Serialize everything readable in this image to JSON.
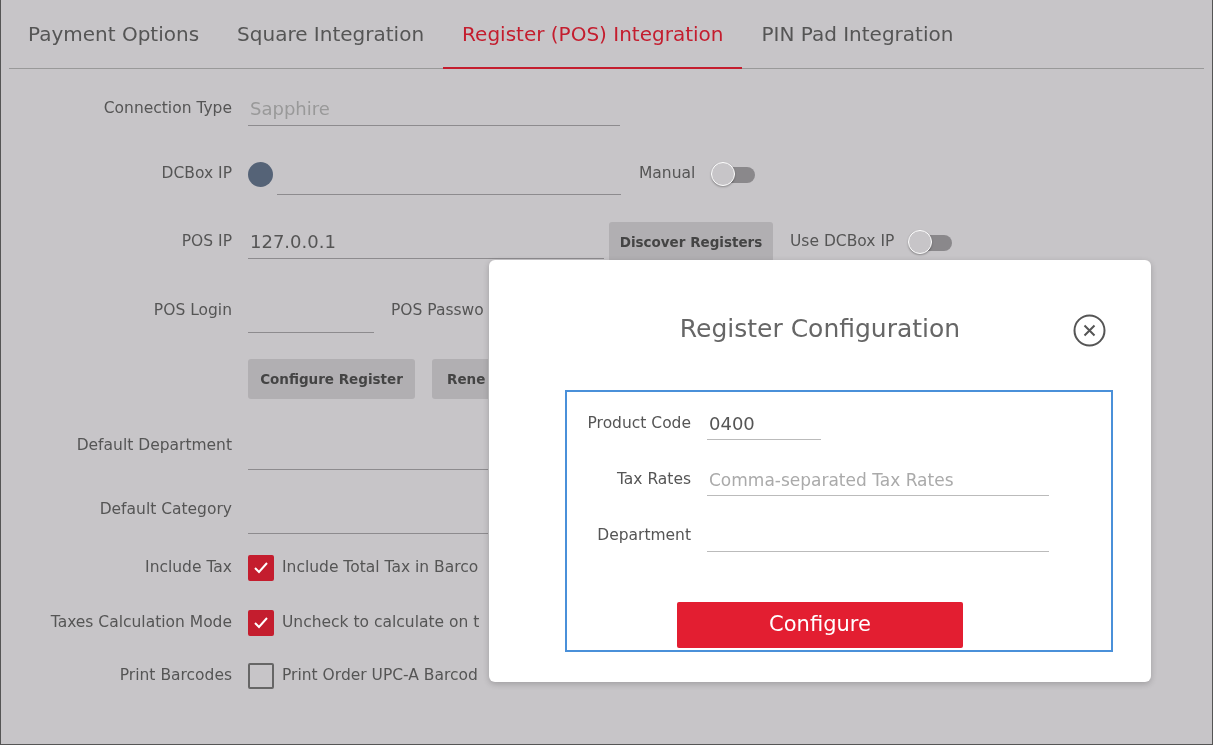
{
  "tabs": [
    {
      "label": "Payment Options",
      "selected": false
    },
    {
      "label": "Square Integration",
      "selected": false
    },
    {
      "label": "Register (POS) Integration",
      "selected": true
    },
    {
      "label": "PIN Pad Integration",
      "selected": false
    }
  ],
  "connection_type": {
    "label": "Connection Type",
    "value": "Sapphire",
    "disabled": true
  },
  "dcbox_ip": {
    "label": "DCBox IP",
    "manual": {
      "label": "Manual",
      "on": false
    }
  },
  "pos_ip": {
    "label": "POS IP",
    "value": "127.0.0.1",
    "button": "Discover Registers",
    "use_dcbox": {
      "label": "Use DCBox IP",
      "on": false
    }
  },
  "pos_login": {
    "label": "POS Login",
    "password_label": "POS Passwo"
  },
  "register_buttons": [
    "Configure Register",
    "Rene"
  ],
  "default_department": {
    "label": "Default Department"
  },
  "default_category": {
    "label": "Default Category"
  },
  "checkboxes": [
    {
      "label": "Include Tax",
      "text": "Include Total Tax in Barco",
      "checked": true
    },
    {
      "label": "Taxes Calculation Mode",
      "text": "Uncheck to calculate on t",
      "checked": true
    },
    {
      "label": "Print Barcodes",
      "text": "Print Order UPC-A Barcod",
      "checked": false
    }
  ],
  "modal": {
    "title": "Register Configuration",
    "fields": [
      {
        "label": "Product Code",
        "value": "0400"
      },
      {
        "label": "Tax Rates",
        "placeholder": "Comma-separated Tax Rates"
      },
      {
        "label": "Department"
      }
    ],
    "button": "Configure"
  }
}
